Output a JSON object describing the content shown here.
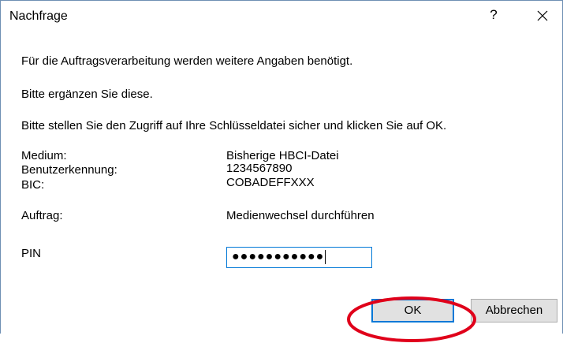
{
  "dialog": {
    "title": "Nachfrage",
    "help_label": "?",
    "close_icon": "close-icon"
  },
  "messages": {
    "line1": "Für die Auftragsverarbeitung werden weitere Angaben benötigt.",
    "line2": "Bitte ergänzen Sie diese.",
    "line3": "Bitte stellen Sie den Zugriff auf Ihre Schlüsseldatei sicher und klicken Sie auf OK."
  },
  "fields": {
    "medium_label": "Medium:",
    "medium_value": "Bisherige HBCI-Datei",
    "user_label": "Benutzerkennung:",
    "user_value": "1234567890",
    "bic_label": "BIC:",
    "bic_value": "COBADEFFXXX",
    "order_label": "Auftrag:",
    "order_value": "Medienwechsel durchführen",
    "pin_label": "PIN",
    "pin_value": "●●●●●●●●●●●"
  },
  "buttons": {
    "ok_label": "OK",
    "cancel_label": "Abbrechen"
  },
  "colors": {
    "accent": "#0078d7",
    "highlight": "#e0001a"
  }
}
